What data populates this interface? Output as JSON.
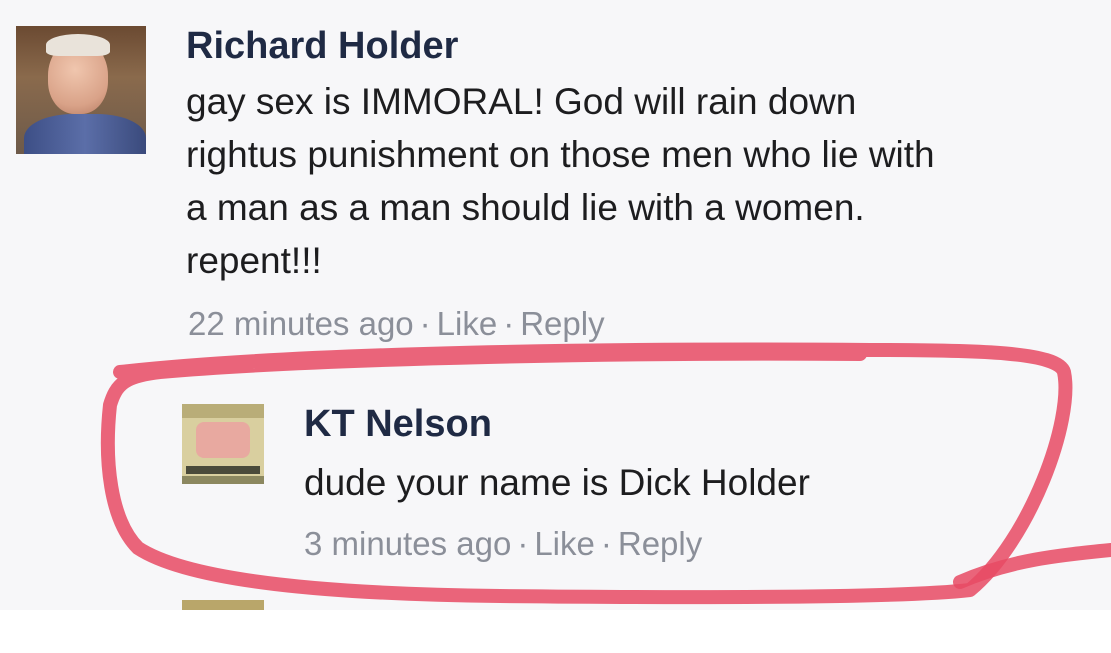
{
  "comments": [
    {
      "author": "Richard Holder",
      "body_lines": [
        "gay sex is IMMORAL! God will rain down",
        "rightus punishment on those men who lie with",
        "a man as a man should lie with a women.",
        "repent!!!"
      ],
      "time": "22 minutes ago",
      "separator": "·",
      "like_label": "Like",
      "reply_label": "Reply"
    },
    {
      "author": "KT Nelson",
      "body_lines": [
        "dude your name is Dick Holder"
      ],
      "time": "3 minutes ago",
      "separator": "·",
      "like_label": "Like",
      "reply_label": "Reply"
    }
  ],
  "colors": {
    "author": "#1f2a44",
    "meta": "#8b8f99",
    "highlight_scribble": "#e84a64",
    "background": "#f7f7f9"
  }
}
